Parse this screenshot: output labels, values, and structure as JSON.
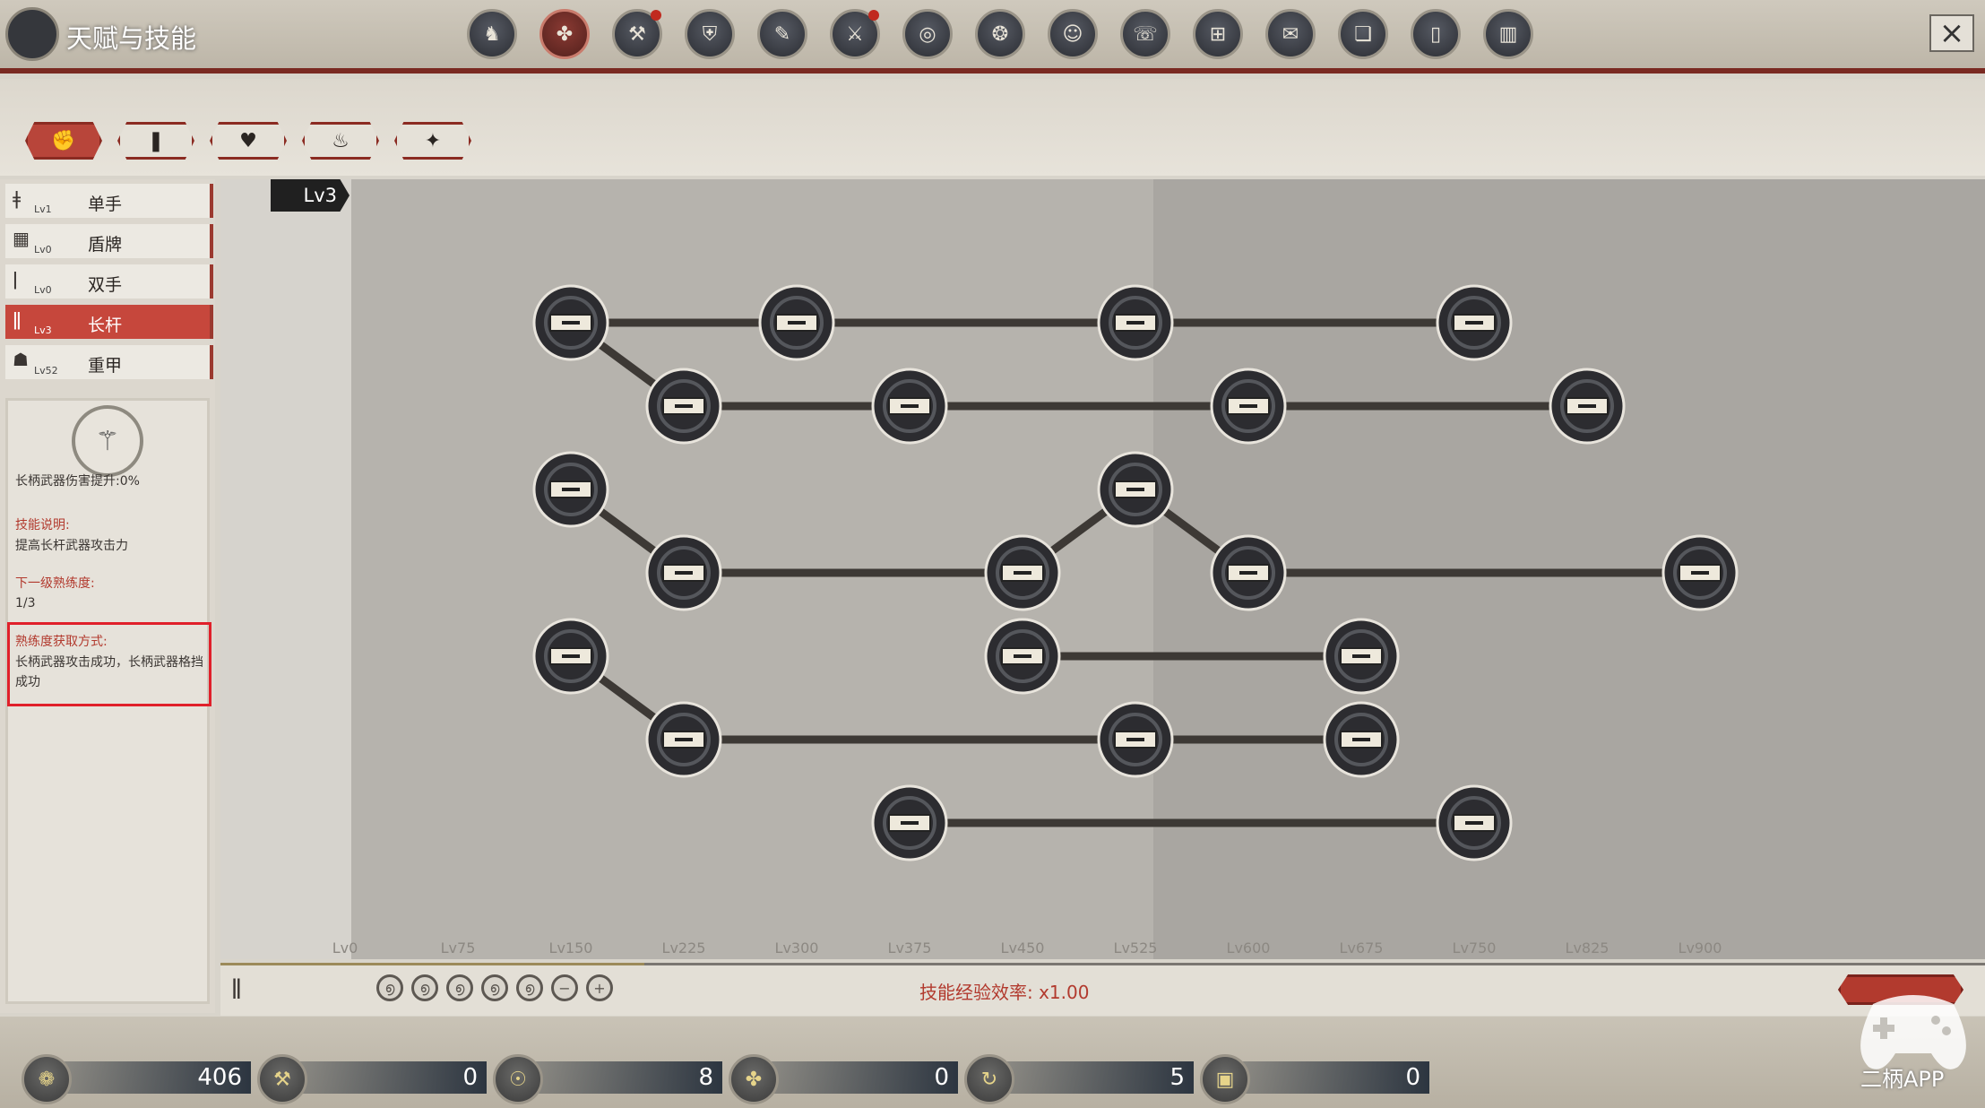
{
  "window": {
    "title": "天赋与技能",
    "close_icon": "×"
  },
  "top_icons": [
    {
      "name": "helmet-icon",
      "glyph": "♞",
      "active": false,
      "dot": false
    },
    {
      "name": "talent-tree-icon",
      "glyph": "✤",
      "active": true,
      "dot": false
    },
    {
      "name": "crafting-icon",
      "glyph": "⚒",
      "active": false,
      "dot": true
    },
    {
      "name": "shield-emblem-icon",
      "glyph": "⛨",
      "active": false,
      "dot": false
    },
    {
      "name": "scroll-icon",
      "glyph": "✎",
      "active": false,
      "dot": false
    },
    {
      "name": "spartan-helmet-icon",
      "glyph": "⚔",
      "active": false,
      "dot": true
    },
    {
      "name": "coin-icon",
      "glyph": "◎",
      "active": false,
      "dot": false
    },
    {
      "name": "dragon-icon",
      "glyph": "❂",
      "active": false,
      "dot": false
    },
    {
      "name": "face-icon",
      "glyph": "☺",
      "active": false,
      "dot": false
    },
    {
      "name": "phone-icon",
      "glyph": "☏",
      "active": false,
      "dot": false
    },
    {
      "name": "map-icon",
      "glyph": "⊞",
      "active": false,
      "dot": false
    },
    {
      "name": "quest-book-icon",
      "glyph": "✉",
      "active": false,
      "dot": false
    },
    {
      "name": "codex-icon",
      "glyph": "❏",
      "active": false,
      "dot": false
    },
    {
      "name": "card-icon",
      "glyph": "▯",
      "active": false,
      "dot": false
    },
    {
      "name": "ranking-icon",
      "glyph": "▥",
      "active": false,
      "dot": false
    }
  ],
  "category_tabs": [
    {
      "name": "tab-combat",
      "glyph": "✊",
      "active": true
    },
    {
      "name": "tab-movement",
      "glyph": "❚",
      "active": false
    },
    {
      "name": "tab-vitality",
      "glyph": "♥",
      "active": false
    },
    {
      "name": "tab-alchemy",
      "glyph": "♨",
      "active": false
    },
    {
      "name": "tab-misc",
      "glyph": "✦",
      "active": false
    }
  ],
  "weapons": [
    {
      "name": "单手",
      "level": "Lv1",
      "glyph": "ǂ",
      "active": false
    },
    {
      "name": "盾牌",
      "level": "Lv0",
      "glyph": "▦",
      "active": false
    },
    {
      "name": "双手",
      "level": "Lv0",
      "glyph": "ǀ",
      "active": false
    },
    {
      "name": "长杆",
      "level": "Lv3",
      "glyph": "ǁ",
      "active": true
    },
    {
      "name": "重甲",
      "level": "Lv52",
      "glyph": "☗",
      "active": false
    }
  ],
  "detail": {
    "emblem": "⚚",
    "bonus": "长柄武器伤害提升:0%",
    "desc_heading": "技能说明:",
    "desc": "提高长杆武器攻击力",
    "next_heading": "下一级熟练度:",
    "next_value": "1/3",
    "gain_heading": "熟练度获取方式:",
    "gain_text": "长柄武器攻击成功，长柄武器格挡成功"
  },
  "tree": {
    "current_level": "Lv3",
    "axis_labels": [
      "Lv0",
      "Lv75",
      "Lv150",
      "Lv225",
      "Lv300",
      "Lv375",
      "Lv450",
      "Lv525",
      "Lv600",
      "Lv675",
      "Lv750",
      "Lv825",
      "Lv900"
    ],
    "nodes": [
      {
        "id": "a1",
        "col": 2,
        "row": 0
      },
      {
        "id": "a2",
        "col": 4,
        "row": 0
      },
      {
        "id": "a3",
        "col": 7,
        "row": 0
      },
      {
        "id": "a4",
        "col": 10,
        "row": 0
      },
      {
        "id": "b1",
        "col": 3,
        "row": 1
      },
      {
        "id": "b2",
        "col": 5,
        "row": 1
      },
      {
        "id": "b3",
        "col": 8,
        "row": 1
      },
      {
        "id": "b4",
        "col": 11,
        "row": 1
      },
      {
        "id": "c1",
        "col": 2,
        "row": 2
      },
      {
        "id": "c2",
        "col": 7,
        "row": 2
      },
      {
        "id": "d1",
        "col": 3,
        "row": 3
      },
      {
        "id": "d2",
        "col": 6,
        "row": 3
      },
      {
        "id": "d3",
        "col": 8,
        "row": 3
      },
      {
        "id": "d4",
        "col": 12,
        "row": 3
      },
      {
        "id": "e1",
        "col": 2,
        "row": 4
      },
      {
        "id": "e2",
        "col": 6,
        "row": 4
      },
      {
        "id": "e3",
        "col": 9,
        "row": 4
      },
      {
        "id": "f1",
        "col": 3,
        "row": 5
      },
      {
        "id": "f2",
        "col": 7,
        "row": 5
      },
      {
        "id": "f3",
        "col": 9,
        "row": 5
      },
      {
        "id": "g1",
        "col": 5,
        "row": 6
      },
      {
        "id": "g2",
        "col": 10,
        "row": 6
      }
    ],
    "links": [
      [
        "a1",
        "a2"
      ],
      [
        "a2",
        "a3"
      ],
      [
        "a3",
        "a4"
      ],
      [
        "a1",
        "b1"
      ],
      [
        "b1",
        "b2"
      ],
      [
        "b2",
        "b3"
      ],
      [
        "b3",
        "b4"
      ],
      [
        "c1",
        "d1"
      ],
      [
        "d1",
        "d2"
      ],
      [
        "d2",
        "c2"
      ],
      [
        "c2",
        "d3"
      ],
      [
        "d3",
        "d4"
      ],
      [
        "e2",
        "e3"
      ],
      [
        "e1",
        "f1"
      ],
      [
        "f1",
        "f2"
      ],
      [
        "f2",
        "f3"
      ],
      [
        "g1",
        "g2"
      ]
    ]
  },
  "footer": {
    "weapon_glyph": "ǁ",
    "exp_rate": "技能经验效率: x1.00",
    "progress_fraction": 0.24,
    "glyphs": [
      "൭",
      "൭",
      "൭",
      "൭",
      "൭",
      "−",
      "+"
    ]
  },
  "resources": [
    {
      "name": "coins-icon",
      "glyph": "❁",
      "value": "406"
    },
    {
      "name": "hammer-icon",
      "glyph": "⚒",
      "value": "0"
    },
    {
      "name": "ouroboros-icon",
      "glyph": "☉",
      "value": "8"
    },
    {
      "name": "talent-point-icon",
      "glyph": "✤",
      "value": "0"
    },
    {
      "name": "cycle-icon",
      "glyph": "↻",
      "value": "5"
    },
    {
      "name": "chest-icon",
      "glyph": "▣",
      "value": "0"
    }
  ],
  "watermark": {
    "text": "二柄APP"
  },
  "colors": {
    "accent_red": "#b23a2e",
    "node_dark": "#2c2c30",
    "link_dark": "#3d3935"
  }
}
